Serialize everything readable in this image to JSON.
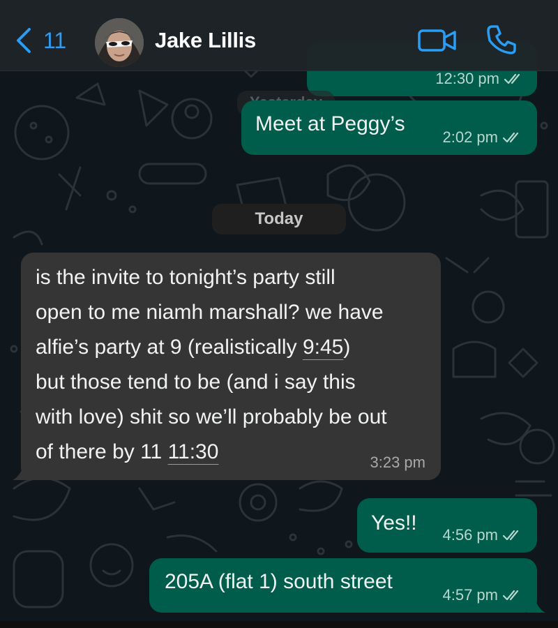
{
  "header": {
    "back_count": "11",
    "contact_name": "Jake Lillis"
  },
  "top_partial_message": {
    "time": "12:30 pm",
    "status": "read"
  },
  "date_labels": {
    "yesterday": "Yesterday",
    "today": "Today"
  },
  "messages": [
    {
      "direction": "outgoing",
      "text": "Meet at Peggy’s",
      "time": "2:02 pm",
      "status": "read"
    },
    {
      "direction": "incoming",
      "lines": [
        "is the invite to tonight’s party still",
        "open to me niamh marshall? we have",
        "alfie’s party at 9 (realistically ",
        "9:45",
        ")",
        "but those tend to be (and i say this",
        "with love) shit so we’ll probably be out",
        "of there by 11 ",
        "11:30"
      ],
      "time": "3:23 pm"
    },
    {
      "direction": "outgoing",
      "text": "Yes!!",
      "time": "4:56 pm",
      "status": "read"
    },
    {
      "direction": "outgoing",
      "text": "205A (flat 1) south street",
      "time": "4:57 pm",
      "status": "read"
    }
  ],
  "colors": {
    "accent": "#2a9df4",
    "outgoing_bubble": "#005c4b",
    "incoming_bubble": "#353535",
    "background": "#10171c"
  },
  "icons": [
    "chevron-left-icon",
    "video-camera-icon",
    "phone-icon",
    "double-check-icon"
  ]
}
